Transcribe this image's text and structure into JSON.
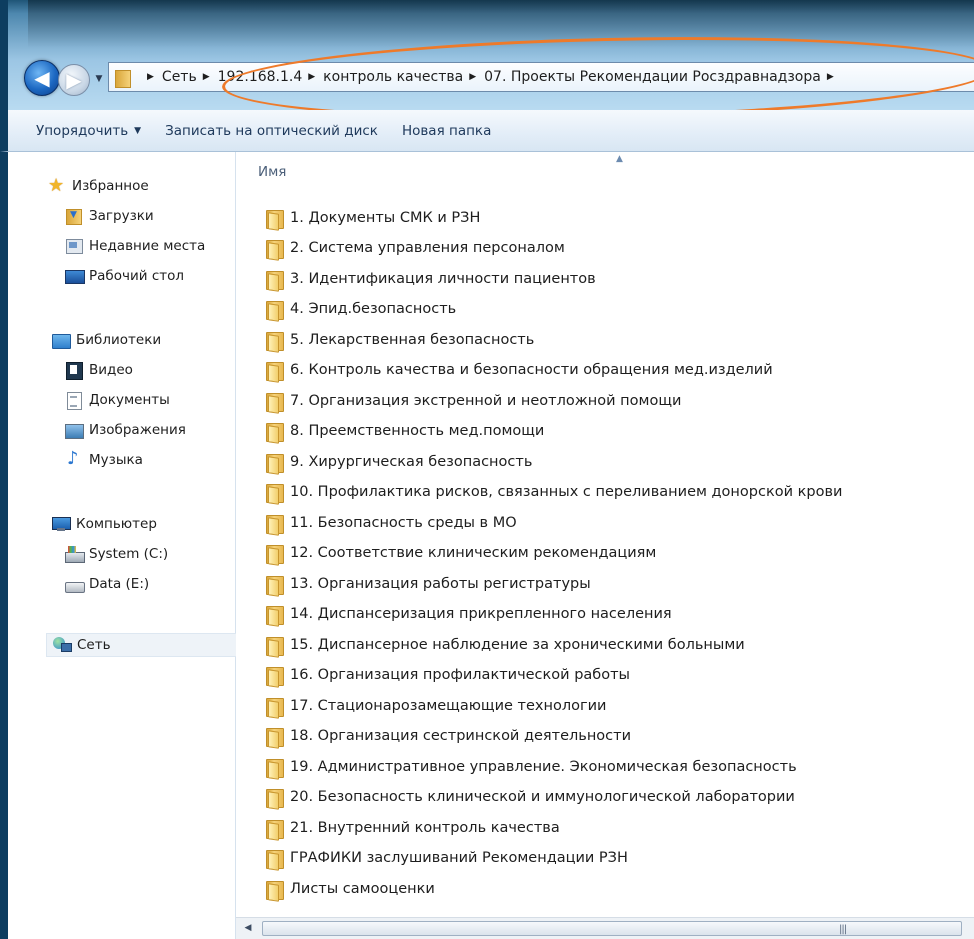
{
  "address_bar": {
    "crumbs": [
      "Сеть",
      "192.168.1.4",
      "контроль качества",
      "07. Проекты Рекомендации Росздравнадзора"
    ]
  },
  "toolbar": {
    "organize": "Упорядочить",
    "burn": "Записать на оптический диск",
    "new_folder": "Новая папка"
  },
  "sidebar": {
    "favorites": "Избранное",
    "downloads": "Загрузки",
    "recent": "Недавние места",
    "desktop": "Рабочий стол",
    "libraries": "Библиотеки",
    "video": "Видео",
    "documents": "Документы",
    "images": "Изображения",
    "music": "Музыка",
    "computer": "Компьютер",
    "drive_c": "System (C:)",
    "drive_e": "Data (E:)",
    "network": "Сеть"
  },
  "content": {
    "column_name": "Имя",
    "folders": [
      "1. Документы СМК и РЗН",
      "2. Система управления персоналом",
      "3. Идентификация личности пациентов",
      "4. Эпид.безопасность",
      "5. Лекарственная безопасность",
      "6. Контроль качества и безопасности обращения мед.изделий",
      "7. Организация экстренной и неотложной помощи",
      "8. Преемственность мед.помощи",
      "9. Хирургическая безопасность",
      "10. Профилактика рисков, связанных с переливанием донорской крови",
      "11. Безопасность среды в МО",
      "12. Соответствие клиническим рекомендациям",
      "13. Организация работы регистратуры",
      "14. Диспансеризация прикрепленного населения",
      "15. Диспансерное наблюдение за хроническими больными",
      "16. Организация профилактической работы",
      "17. Стационарозамещающие технологии",
      "18. Организация сестринской деятельности",
      "19. Административное управление. Экономическая безопасность",
      "20. Безопасность клинической и иммунологической лаборатории",
      "21. Внутренний контроль качества",
      "ГРАФИКИ заслушиваний Рекомендации РЗН",
      "Листы самооценки"
    ]
  },
  "colors": {
    "highlight": "#ee7a2a",
    "titlebar": "#4d87ae",
    "toolbar_text": "#1e395b"
  }
}
